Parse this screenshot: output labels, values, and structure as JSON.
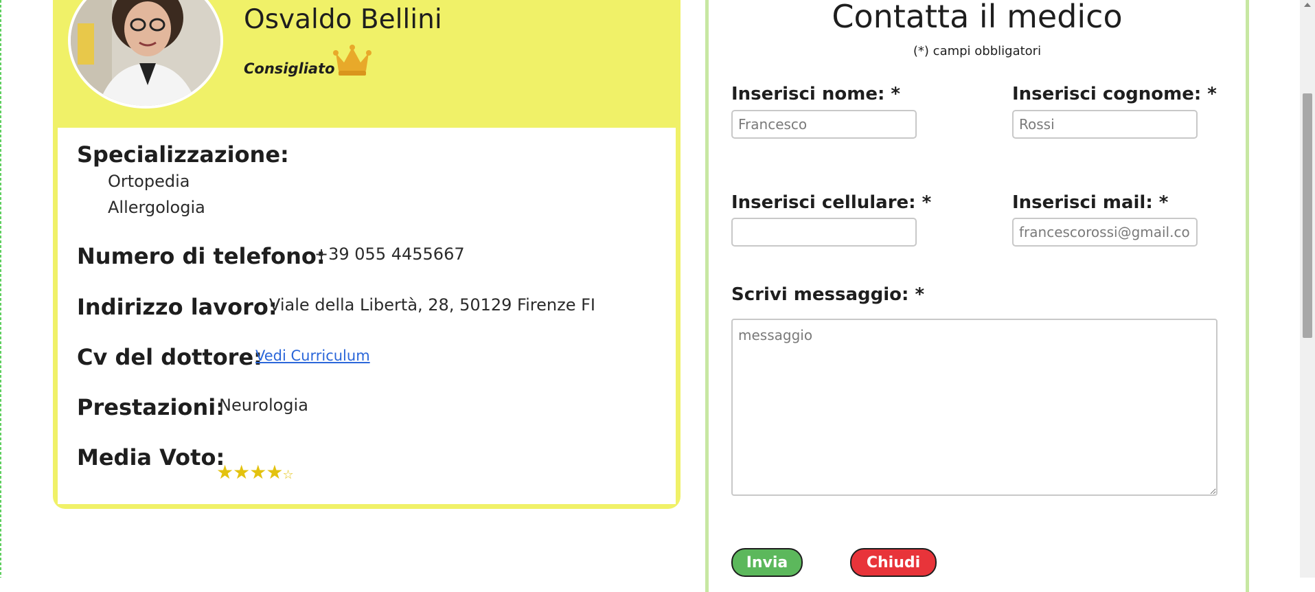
{
  "doctor": {
    "name": "Osvaldo Bellini",
    "badge": "Consigliato",
    "specialization_label": "Specializzazione:",
    "specializations": [
      "Ortopedia",
      "Allergologia"
    ],
    "phone_label": "Numero di telefono:",
    "phone": "+39 055 4455667",
    "address_label": "Indirizzo lavoro:",
    "address": "Viale della Libertà, 28, 50129 Firenze FI",
    "cv_label": "Cv del dottore:",
    "cv_link": "Vedi Curriculum",
    "services_label": "Prestazioni:",
    "services": "Neurologia",
    "rating_label": "Media Voto:",
    "rating": 4,
    "rating_max": 5
  },
  "contact_form": {
    "title": "Contatta il medico",
    "required_note": "(*) campi obbligatori",
    "first_name_label": "Inserisci nome: *",
    "first_name_placeholder": "Francesco",
    "last_name_label": "Inserisci cognome: *",
    "last_name_placeholder": "Rossi",
    "phone_label": "Inserisci cellulare: *",
    "phone_placeholder": "",
    "email_label": "Inserisci mail: *",
    "email_placeholder": "francescorossi@gmail.com",
    "message_label": "Scrivi messaggio: *",
    "message_placeholder": "messaggio",
    "send_button": "Invia",
    "close_button": "Chiudi"
  },
  "colors": {
    "card_yellow": "#f0f168",
    "panel_border_green": "#c7e7a2",
    "send_green": "#5cb85c",
    "close_red": "#e8343a",
    "star_gold": "#e3c20f",
    "link_blue": "#2a66d9"
  }
}
